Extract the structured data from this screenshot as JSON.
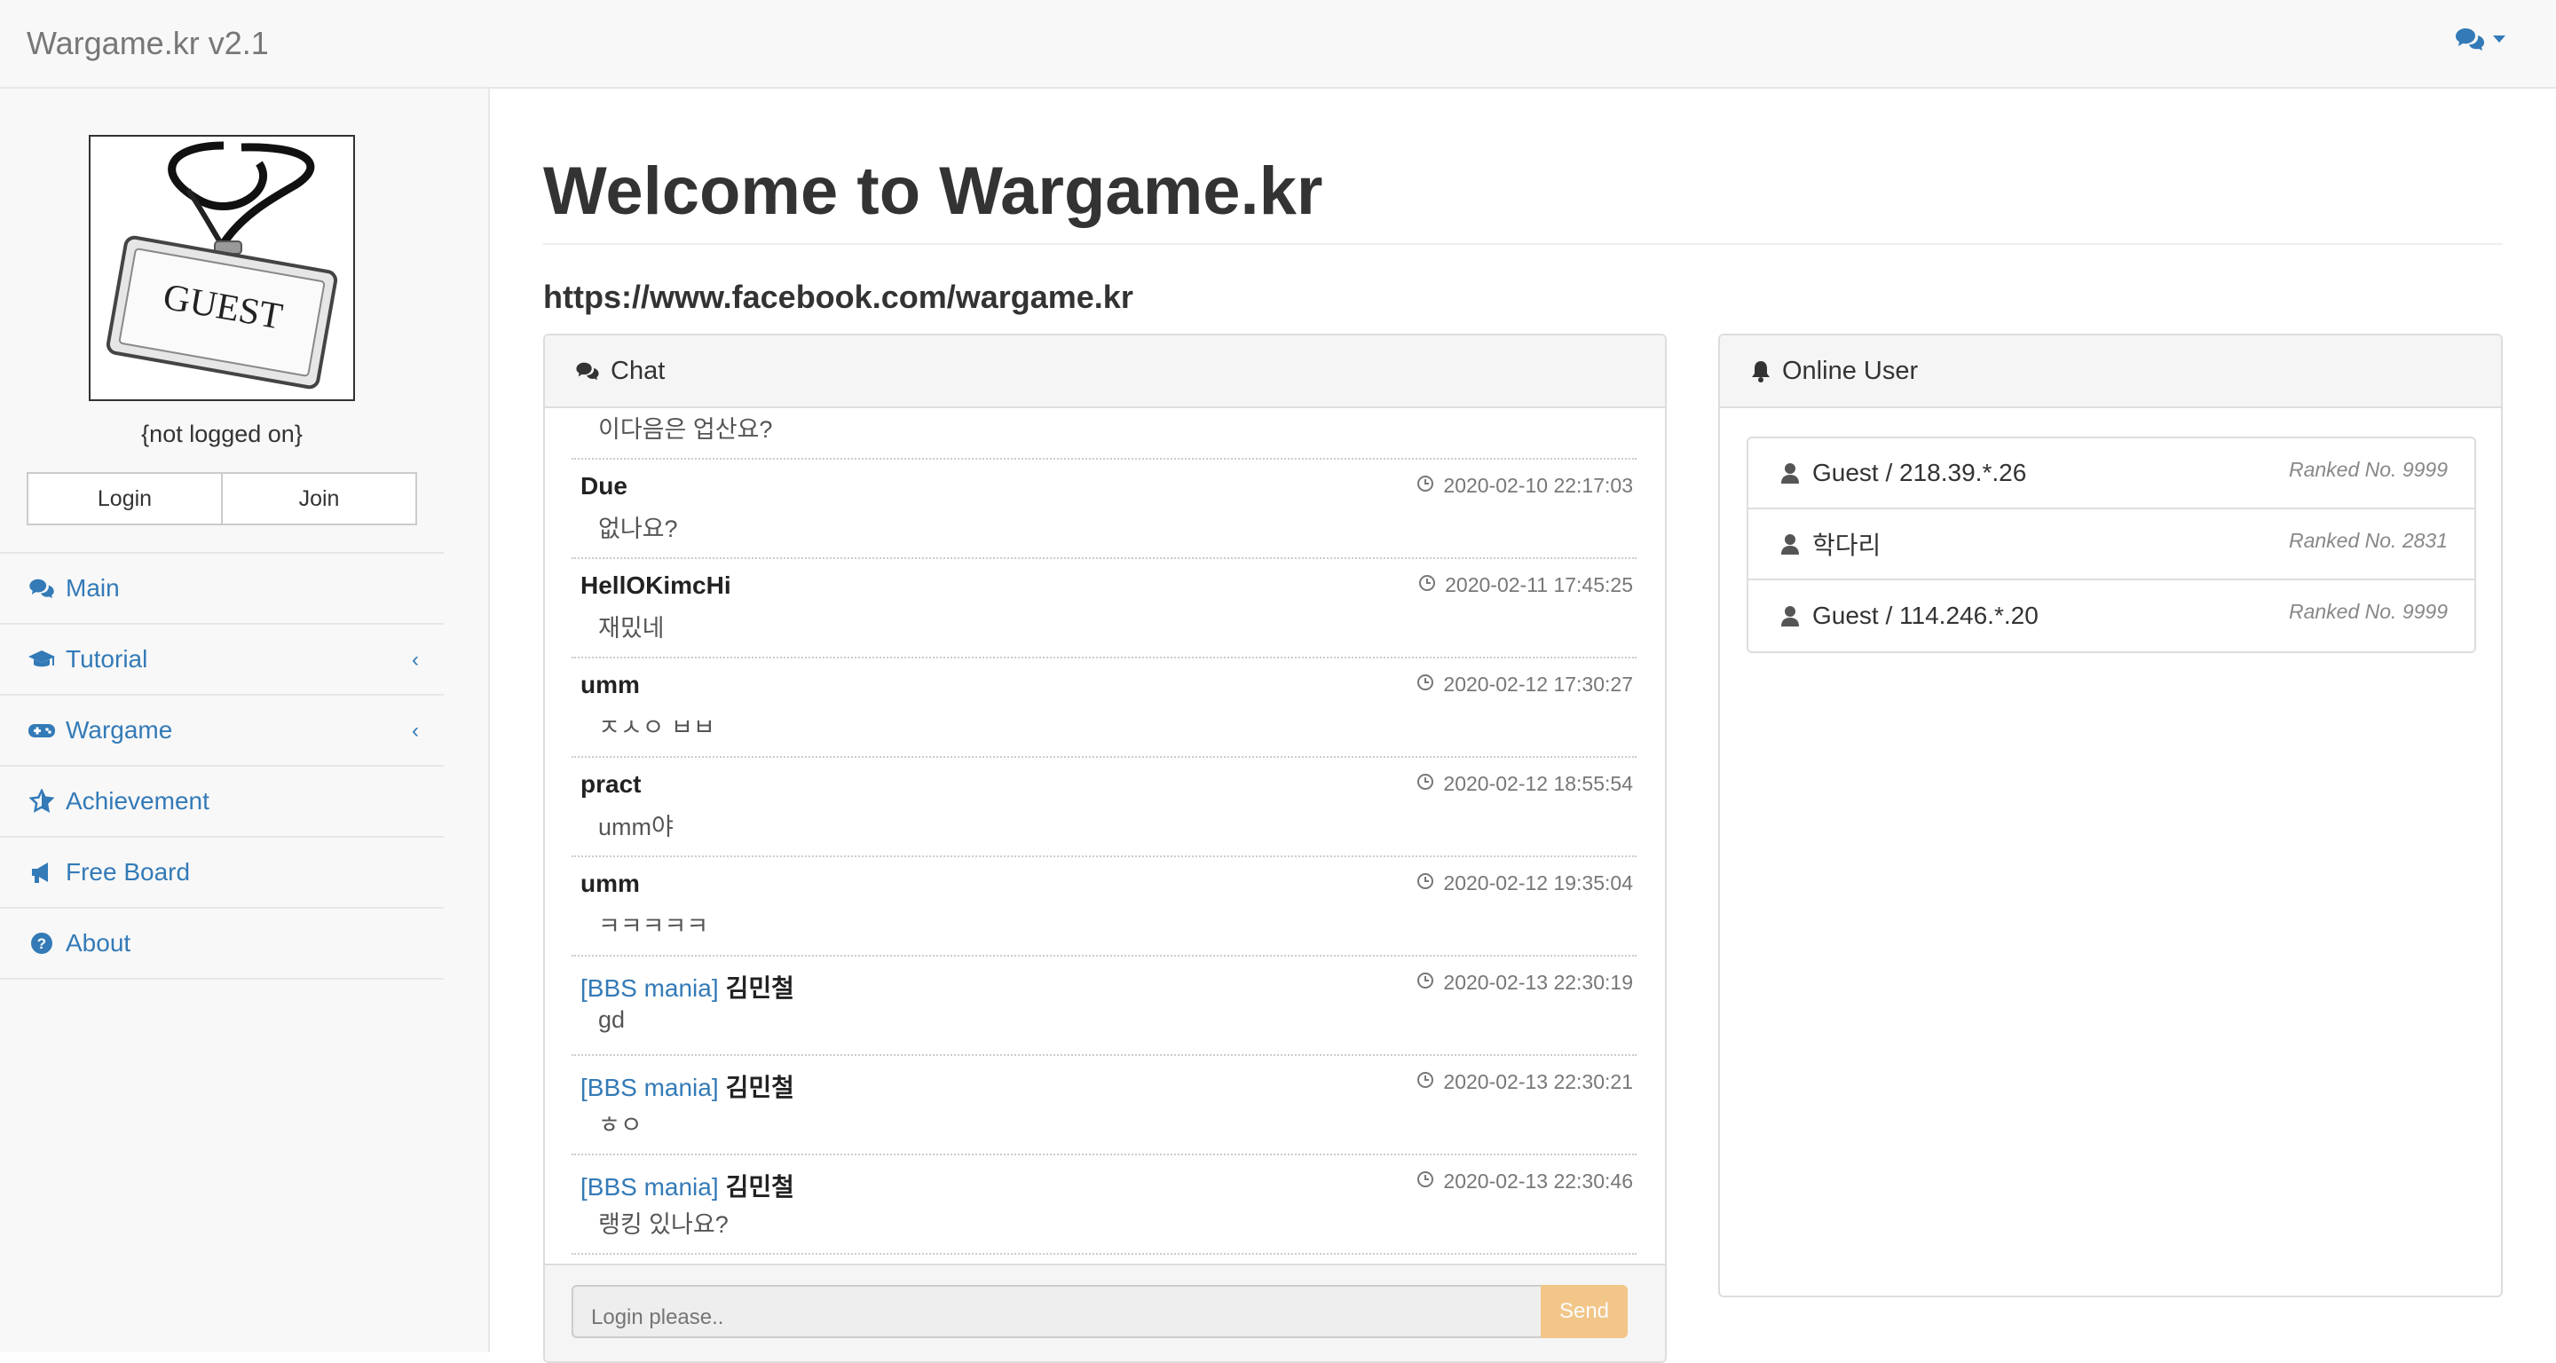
{
  "navbar": {
    "brand": "Wargame.kr v2.1",
    "lang_icon": "comments-icon"
  },
  "sidebar": {
    "avatar_text": "GUEST",
    "login_status": "{not logged on}",
    "login_label": "Login",
    "join_label": "Join",
    "items": [
      {
        "label": "Main",
        "icon": "comments-icon"
      },
      {
        "label": "Tutorial",
        "icon": "graduation-cap-icon"
      },
      {
        "label": "Wargame",
        "icon": "gamepad-icon"
      },
      {
        "label": "Achievement",
        "icon": "star-icon"
      },
      {
        "label": "Free Board",
        "icon": "bullhorn-icon"
      },
      {
        "label": "About",
        "icon": "question-circle-icon"
      }
    ],
    "accent": "#337ab7"
  },
  "main": {
    "title": "Welcome to Wargame.kr",
    "link": "https://www.facebook.com/wargame.kr"
  },
  "chat": {
    "title": "Chat",
    "messages": [
      {
        "text": "이다음은 업산요?"
      },
      {
        "user": "Due",
        "time": "2020-02-10 22:17:03",
        "text": "없나요?"
      },
      {
        "user": "HellOKimcHi",
        "time": "2020-02-11 17:45:25",
        "text": "재밌네"
      },
      {
        "user": "umm",
        "time": "2020-02-12 17:30:27",
        "text": "ㅈㅅㅇ ㅂㅂ"
      },
      {
        "user": "pract",
        "time": "2020-02-12 18:55:54",
        "text": "umm야"
      },
      {
        "user": "umm",
        "time": "2020-02-12 19:35:04",
        "text": "ㅋㅋㅋㅋㅋ"
      },
      {
        "tag": "[BBS mania]",
        "user": "김민철",
        "time": "2020-02-13 22:30:19",
        "text": "gd"
      },
      {
        "tag": "[BBS mania]",
        "user": "김민철",
        "time": "2020-02-13 22:30:21",
        "text": "ㅎㅇ"
      },
      {
        "tag": "[BBS mania]",
        "user": "김민철",
        "time": "2020-02-13 22:30:46",
        "text": "랭킹 있나요?"
      }
    ],
    "input_placeholder": "Login please..",
    "send_label": "Send",
    "send_color": "#f0ad4e"
  },
  "online": {
    "title": "Online User",
    "users": [
      {
        "name": "Guest / 218.39.*.26",
        "rank": "Ranked No. 9999"
      },
      {
        "name": "학다리",
        "rank": "Ranked No. 2831"
      },
      {
        "name": "Guest / 114.246.*.20",
        "rank": "Ranked No. 9999"
      }
    ]
  }
}
